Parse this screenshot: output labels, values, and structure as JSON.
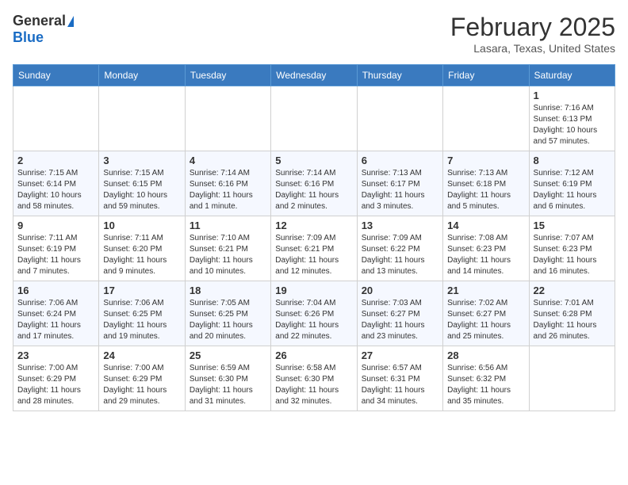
{
  "header": {
    "logo_general": "General",
    "logo_blue": "Blue",
    "month_title": "February 2025",
    "location": "Lasara, Texas, United States"
  },
  "days_of_week": [
    "Sunday",
    "Monday",
    "Tuesday",
    "Wednesday",
    "Thursday",
    "Friday",
    "Saturday"
  ],
  "weeks": [
    [
      {
        "day": "",
        "info": ""
      },
      {
        "day": "",
        "info": ""
      },
      {
        "day": "",
        "info": ""
      },
      {
        "day": "",
        "info": ""
      },
      {
        "day": "",
        "info": ""
      },
      {
        "day": "",
        "info": ""
      },
      {
        "day": "1",
        "info": "Sunrise: 7:16 AM\nSunset: 6:13 PM\nDaylight: 10 hours and 57 minutes."
      }
    ],
    [
      {
        "day": "2",
        "info": "Sunrise: 7:15 AM\nSunset: 6:14 PM\nDaylight: 10 hours and 58 minutes."
      },
      {
        "day": "3",
        "info": "Sunrise: 7:15 AM\nSunset: 6:15 PM\nDaylight: 10 hours and 59 minutes."
      },
      {
        "day": "4",
        "info": "Sunrise: 7:14 AM\nSunset: 6:16 PM\nDaylight: 11 hours and 1 minute."
      },
      {
        "day": "5",
        "info": "Sunrise: 7:14 AM\nSunset: 6:16 PM\nDaylight: 11 hours and 2 minutes."
      },
      {
        "day": "6",
        "info": "Sunrise: 7:13 AM\nSunset: 6:17 PM\nDaylight: 11 hours and 3 minutes."
      },
      {
        "day": "7",
        "info": "Sunrise: 7:13 AM\nSunset: 6:18 PM\nDaylight: 11 hours and 5 minutes."
      },
      {
        "day": "8",
        "info": "Sunrise: 7:12 AM\nSunset: 6:19 PM\nDaylight: 11 hours and 6 minutes."
      }
    ],
    [
      {
        "day": "9",
        "info": "Sunrise: 7:11 AM\nSunset: 6:19 PM\nDaylight: 11 hours and 7 minutes."
      },
      {
        "day": "10",
        "info": "Sunrise: 7:11 AM\nSunset: 6:20 PM\nDaylight: 11 hours and 9 minutes."
      },
      {
        "day": "11",
        "info": "Sunrise: 7:10 AM\nSunset: 6:21 PM\nDaylight: 11 hours and 10 minutes."
      },
      {
        "day": "12",
        "info": "Sunrise: 7:09 AM\nSunset: 6:21 PM\nDaylight: 11 hours and 12 minutes."
      },
      {
        "day": "13",
        "info": "Sunrise: 7:09 AM\nSunset: 6:22 PM\nDaylight: 11 hours and 13 minutes."
      },
      {
        "day": "14",
        "info": "Sunrise: 7:08 AM\nSunset: 6:23 PM\nDaylight: 11 hours and 14 minutes."
      },
      {
        "day": "15",
        "info": "Sunrise: 7:07 AM\nSunset: 6:23 PM\nDaylight: 11 hours and 16 minutes."
      }
    ],
    [
      {
        "day": "16",
        "info": "Sunrise: 7:06 AM\nSunset: 6:24 PM\nDaylight: 11 hours and 17 minutes."
      },
      {
        "day": "17",
        "info": "Sunrise: 7:06 AM\nSunset: 6:25 PM\nDaylight: 11 hours and 19 minutes."
      },
      {
        "day": "18",
        "info": "Sunrise: 7:05 AM\nSunset: 6:25 PM\nDaylight: 11 hours and 20 minutes."
      },
      {
        "day": "19",
        "info": "Sunrise: 7:04 AM\nSunset: 6:26 PM\nDaylight: 11 hours and 22 minutes."
      },
      {
        "day": "20",
        "info": "Sunrise: 7:03 AM\nSunset: 6:27 PM\nDaylight: 11 hours and 23 minutes."
      },
      {
        "day": "21",
        "info": "Sunrise: 7:02 AM\nSunset: 6:27 PM\nDaylight: 11 hours and 25 minutes."
      },
      {
        "day": "22",
        "info": "Sunrise: 7:01 AM\nSunset: 6:28 PM\nDaylight: 11 hours and 26 minutes."
      }
    ],
    [
      {
        "day": "23",
        "info": "Sunrise: 7:00 AM\nSunset: 6:29 PM\nDaylight: 11 hours and 28 minutes."
      },
      {
        "day": "24",
        "info": "Sunrise: 7:00 AM\nSunset: 6:29 PM\nDaylight: 11 hours and 29 minutes."
      },
      {
        "day": "25",
        "info": "Sunrise: 6:59 AM\nSunset: 6:30 PM\nDaylight: 11 hours and 31 minutes."
      },
      {
        "day": "26",
        "info": "Sunrise: 6:58 AM\nSunset: 6:30 PM\nDaylight: 11 hours and 32 minutes."
      },
      {
        "day": "27",
        "info": "Sunrise: 6:57 AM\nSunset: 6:31 PM\nDaylight: 11 hours and 34 minutes."
      },
      {
        "day": "28",
        "info": "Sunrise: 6:56 AM\nSunset: 6:32 PM\nDaylight: 11 hours and 35 minutes."
      },
      {
        "day": "",
        "info": ""
      }
    ]
  ]
}
